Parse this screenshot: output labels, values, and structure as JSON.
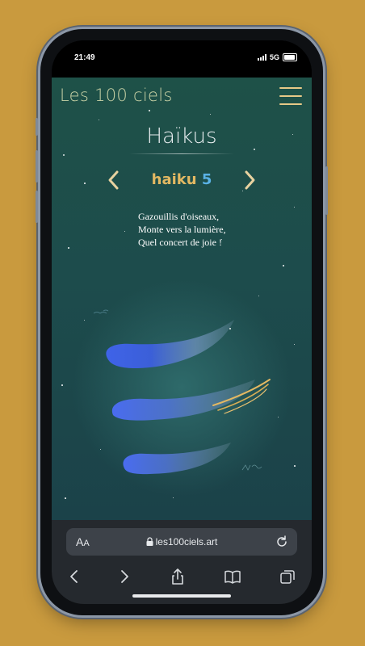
{
  "status": {
    "time": "21:49",
    "network": "5G"
  },
  "site": {
    "logo": "Les 100 ciels",
    "menu_icon": "hamburger-menu-icon"
  },
  "page": {
    "title": "Haïkus",
    "haiku_word": "haiku",
    "haiku_number": "5",
    "prev_icon": "chevron-left-icon",
    "next_icon": "chevron-right-icon",
    "poem": [
      "Gazouillis d'oiseaux,",
      "Monte vers la lumière,",
      "Quel concert de joie !"
    ]
  },
  "browser": {
    "text_size_label_big": "A",
    "text_size_label_small": "A",
    "url": "les100ciels.art",
    "lock_icon": "lock-icon",
    "reload_icon": "reload-icon",
    "nav": [
      "back-icon",
      "forward-icon",
      "share-icon",
      "bookmarks-icon",
      "tabs-icon"
    ]
  },
  "colors": {
    "background": "#c99a3e",
    "gold": "#e3b862",
    "blue_number": "#5ab2e6",
    "sky": "#1d4c4c"
  }
}
